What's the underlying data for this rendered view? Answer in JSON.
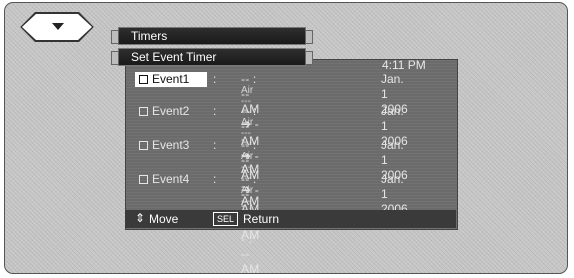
{
  "menu": {
    "title": "Timers",
    "subtitle": "Set Event Timer",
    "clock": "4:11 PM"
  },
  "events": [
    {
      "label": "Event1",
      "colon": ":",
      "time": "-- : -- AM  ➔  -- : -- AM",
      "date": "Jan. 1 2006",
      "air": "Air  ------",
      "selected": true
    },
    {
      "label": "Event2",
      "colon": ":",
      "time": "-- : -- AM  ➔  -- : -- AM",
      "date": "Jan. 1 2006",
      "air": "Air  ------",
      "selected": false
    },
    {
      "label": "Event3",
      "colon": ":",
      "time": "-- : -- AM  ➔  -- : -- AM",
      "date": "Jan. 1 2006",
      "air": "Air  ------",
      "selected": false
    },
    {
      "label": "Event4",
      "colon": ":",
      "time": "-- : -- AM  ➔  -- : -- AM",
      "date": "Jan. 1 2006",
      "air": "Air  ------",
      "selected": false
    }
  ],
  "footer": {
    "move_icon": "⇕",
    "move_label": "Move",
    "sel_icon": "SEL",
    "return_label": "Return"
  }
}
